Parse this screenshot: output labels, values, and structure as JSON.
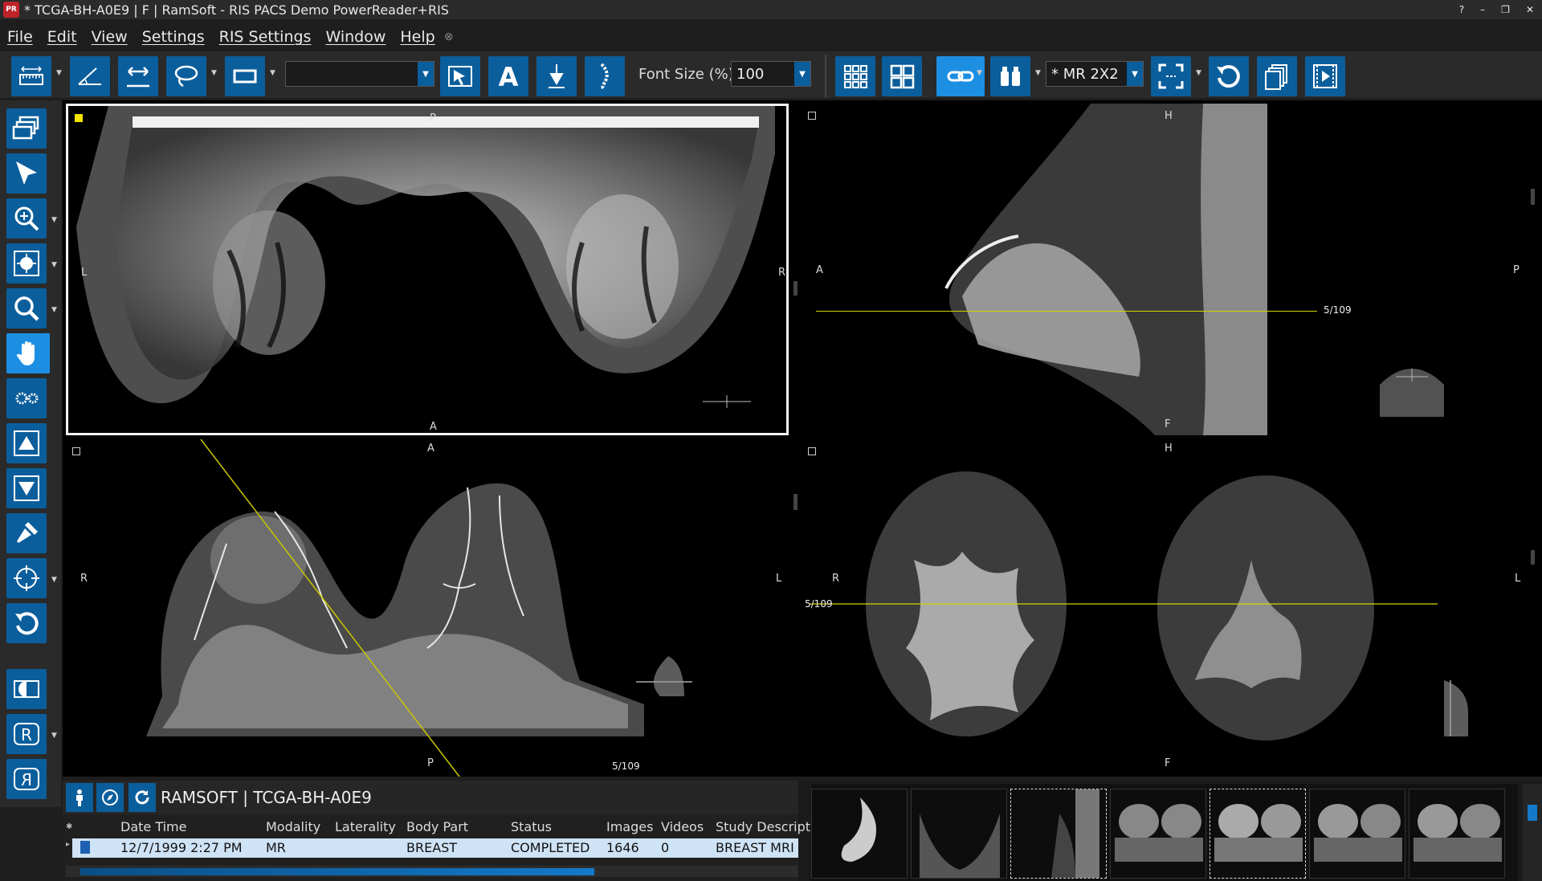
{
  "window": {
    "title": "* TCGA-BH-A0E9 | F | RamSoft - RIS PACS Demo PowerReader+RIS",
    "controls": [
      "?",
      "–",
      "❐",
      "✕"
    ]
  },
  "menu": {
    "items": [
      "File",
      "Edit",
      "View",
      "Settings",
      "RIS Settings",
      "Window",
      "Help"
    ]
  },
  "toolbar": {
    "font_size_label": "Font Size (%)",
    "font_size_value": "100",
    "combo_blank": "",
    "layout_value": "* MR 2X2"
  },
  "viewports": [
    {
      "id": "axial",
      "orient": {
        "top": "P",
        "bottom": "A",
        "left": "L",
        "right": "R"
      },
      "slice": ""
    },
    {
      "id": "sagittal",
      "orient": {
        "top": "H",
        "bottom": "F",
        "left": "A",
        "right": "P"
      },
      "slice": "5/109"
    },
    {
      "id": "mip",
      "orient": {
        "top": "A",
        "bottom": "P",
        "left": "R",
        "right": "L"
      },
      "slice": "5/109"
    },
    {
      "id": "coronal",
      "orient": {
        "top": "H",
        "bottom": "F",
        "left": "R",
        "right": "L"
      },
      "slice": "5/109"
    }
  ],
  "study": {
    "title": "RAMSOFT | TCGA-BH-A0E9",
    "columns": [
      "Date Time",
      "Modality",
      "Laterality",
      "Body Part",
      "Status",
      "Images",
      "Videos",
      "Study Descript"
    ],
    "row": [
      "12/7/1999 2:27 PM",
      "MR",
      "",
      "BREAST",
      "COMPLETED",
      "1646",
      "0",
      "BREAST MRI"
    ]
  }
}
